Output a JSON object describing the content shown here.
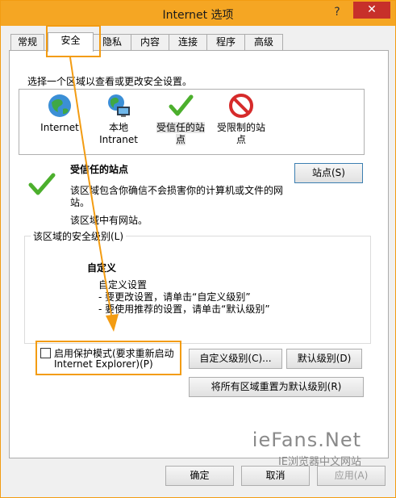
{
  "window": {
    "title": "Internet 选项",
    "help_icon": "?",
    "close_icon": "✕"
  },
  "tabs": [
    {
      "label": "常规"
    },
    {
      "label": "安全"
    },
    {
      "label": "隐私"
    },
    {
      "label": "内容"
    },
    {
      "label": "连接"
    },
    {
      "label": "程序"
    },
    {
      "label": "高级"
    }
  ],
  "security": {
    "select_zone_text": "选择一个区域以查看或更改安全设置。",
    "zones": [
      {
        "line1": "Internet",
        "line2": "",
        "icon": "globe-icon"
      },
      {
        "line1": "本地",
        "line2": "Intranet",
        "icon": "local-intranet-icon"
      },
      {
        "line1": "受信任的站",
        "line2": "点",
        "icon": "check-icon"
      },
      {
        "line1": "受限制的站",
        "line2": "点",
        "icon": "restricted-icon"
      }
    ],
    "selected_zone": {
      "title": "受信任的站点",
      "desc1": "该区域包含你确信不会损害你的计算机或文件的网",
      "desc2": "站。",
      "desc3": "该区域中有网站。"
    },
    "sites_button": "站点(S)",
    "level_group": {
      "title": "该区域的安全级别(L)",
      "custom_heading": "自定义",
      "custom_line1": "自定义设置",
      "custom_line2": "- 要更改设置，请单击“自定义级别”",
      "custom_line3": "- 要使用推荐的设置，请单击“默认级别”"
    },
    "protected_mode": {
      "label_line1": "启用保护模式(要求重新启动",
      "label_line2": "Internet Explorer)(P)",
      "checked": false
    },
    "custom_level_button": "自定义级别(C)...",
    "default_level_button": "默认级别(D)",
    "reset_all_button": "将所有区域重置为默认级别(R)"
  },
  "footer": {
    "ok": "确定",
    "cancel": "取消",
    "apply": "应用(A)"
  },
  "watermark": {
    "brand": "ieFans.Net",
    "tagline": "IE浏览器中文网站"
  }
}
